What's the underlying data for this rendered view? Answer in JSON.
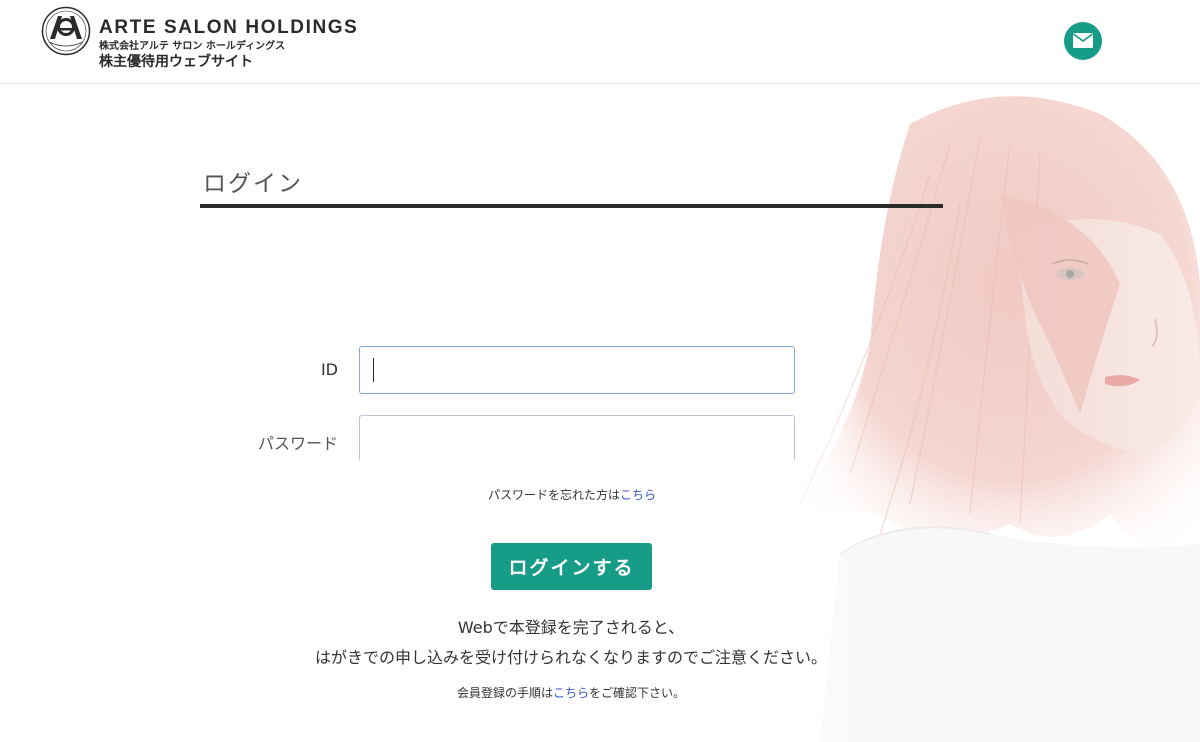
{
  "header": {
    "brand_en": "ARTE SALON HOLDINGS",
    "brand_jp": "株式会社アルテ サロン ホールディングス",
    "site_name": "株主優待用ウェブサイト",
    "mail_icon": "mail-icon",
    "accent_color": "#179c87"
  },
  "login": {
    "title": "ログイン",
    "id_label": "ID",
    "id_value": "",
    "password_label": "パスワード",
    "password_value": "",
    "forgot_text": "パスワードを忘れた方は",
    "forgot_link": "こちら",
    "submit_label": "ログインする"
  },
  "notice": {
    "line1": "Webで本登録を完了されると、",
    "line2": "はがきでの申し込みを受け付けられなくなりますのでご注意ください。",
    "register_prefix": "会員登録の手順は",
    "register_link": "こちら",
    "register_suffix": "をご確認下さい。"
  }
}
